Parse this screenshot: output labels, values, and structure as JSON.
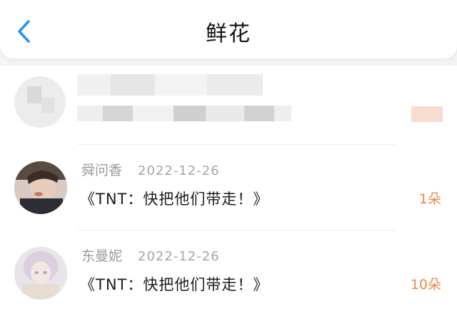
{
  "header": {
    "title": "鲜花",
    "back_icon": "chevron-left-icon",
    "back_color": "#2a8ef0"
  },
  "records": [
    {
      "username": "舜问香",
      "date": "2022-12-26",
      "message": "《TNT：快把他们带走！》",
      "count": "1朵"
    },
    {
      "username": "东曼妮",
      "date": "2022-12-26",
      "message": "《TNT：快把他们带走！》",
      "count": "10朵"
    }
  ],
  "colors": {
    "accent": "#e88a4a",
    "muted_text": "#9a9a9a"
  }
}
